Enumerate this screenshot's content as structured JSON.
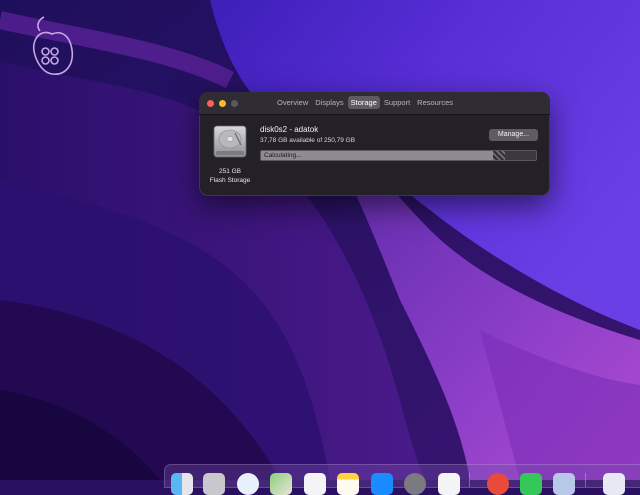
{
  "window": {
    "tabs": [
      "Overview",
      "Displays",
      "Storage",
      "Support",
      "Resources"
    ],
    "active_tab": "Storage"
  },
  "storage": {
    "capacity": "251 GB",
    "type": "Flash Storage",
    "disk_name": "disk0s2 - adatok",
    "available_text": "37,78 GB available of 250,79 GB",
    "manage_label": "Manage...",
    "status_text": "Calculating...",
    "used_fraction": 0.85
  },
  "colors": {
    "accent_close": "#ff5f57",
    "accent_minimize": "#febc2e"
  },
  "dock": {
    "icons": [
      "finder-icon",
      "launchpad-icon",
      "safari-icon",
      "maps-icon",
      "photos-icon",
      "notes-icon",
      "app-store-icon",
      "system-preferences-icon",
      "slack-icon",
      "chrome-icon",
      "messages-icon",
      "preview-icon",
      "document-icon"
    ]
  }
}
